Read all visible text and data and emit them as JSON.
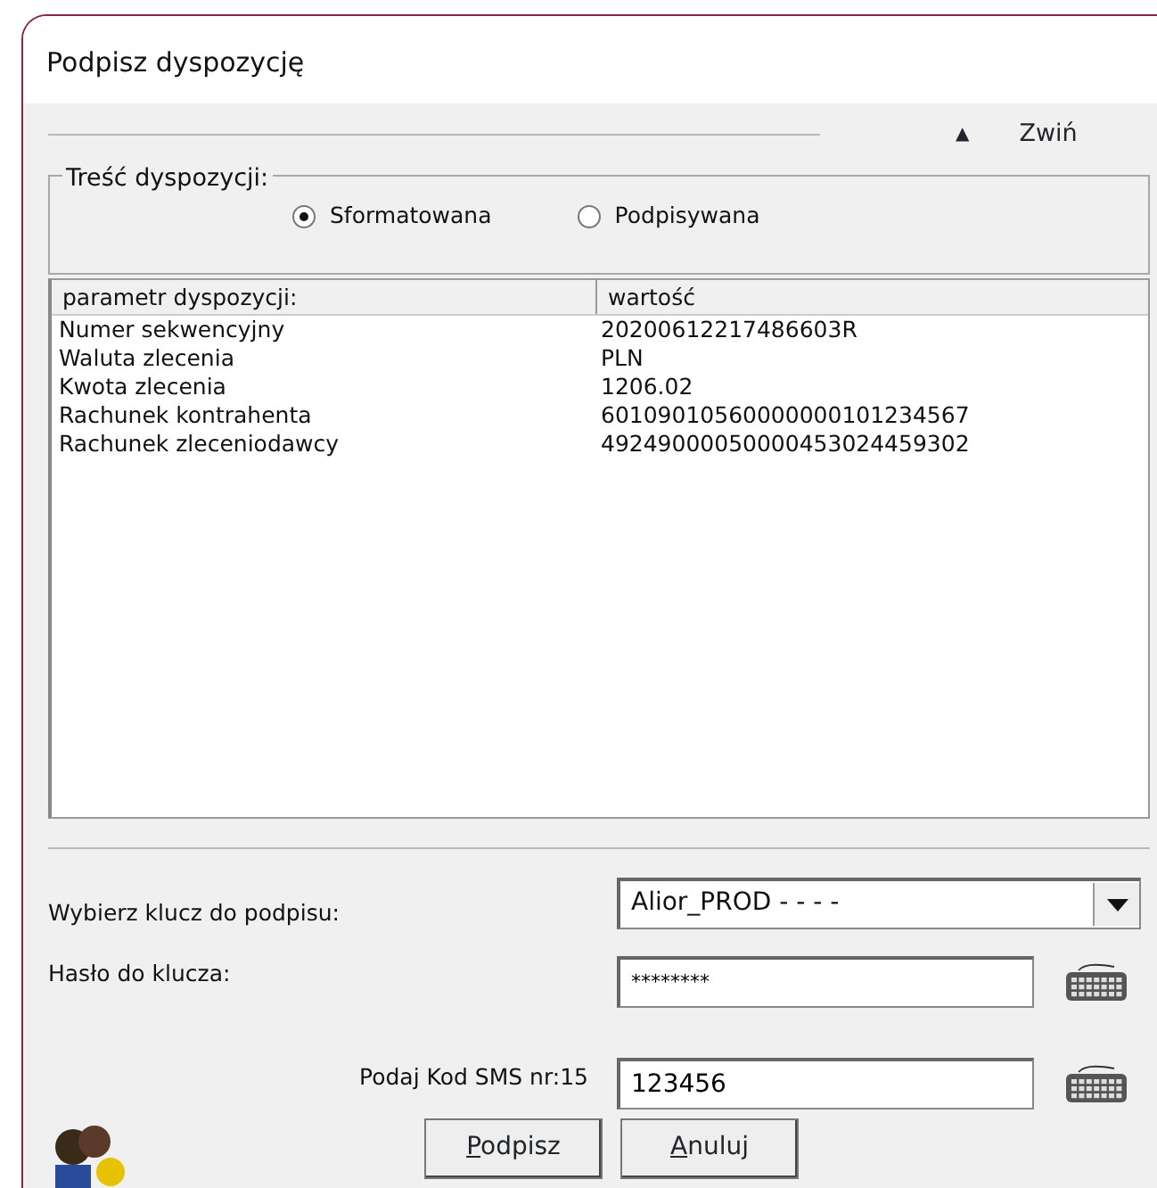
{
  "window": {
    "title": "Podpisz dyspozycję"
  },
  "collapse": {
    "icon": "▲",
    "label": "Zwiń"
  },
  "content_group": {
    "title": "Treść dyspozycji:",
    "options": [
      {
        "label": "Sformatowana",
        "selected": true
      },
      {
        "label": "Podpisywana",
        "selected": false
      }
    ]
  },
  "table": {
    "columns": [
      "parametr dyspozycji:",
      "wartość"
    ],
    "rows": [
      [
        "Numer sekwencyjny",
        "20200612217486603R"
      ],
      [
        "Waluta zlecenia",
        "PLN"
      ],
      [
        "Kwota zlecenia",
        "1206.02"
      ],
      [
        "Rachunek kontrahenta",
        "60109010560000000101234567"
      ],
      [
        "Rachunek zleceniodawcy",
        "49249000050000453024459302"
      ]
    ]
  },
  "form": {
    "key": {
      "label": "Wybierz klucz do podpisu:",
      "value": "Alior_PROD - - - -"
    },
    "password": {
      "label": "Hasło do klucza:",
      "value": "********"
    },
    "sms": {
      "label": "Podaj Kod SMS nr:15",
      "value": "123456"
    }
  },
  "buttons": [
    {
      "label": "Podpisz",
      "mnemonic": true
    },
    {
      "label": "Anuluj",
      "mnemonic": true
    }
  ]
}
